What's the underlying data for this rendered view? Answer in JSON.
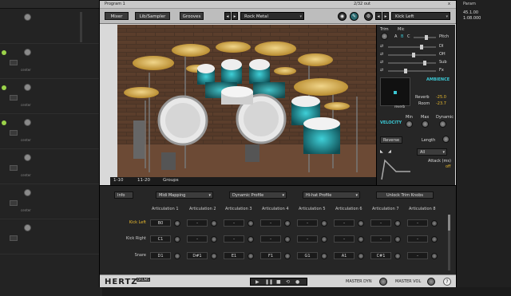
{
  "daw": {
    "top_left_label": "",
    "channel_label": "center",
    "transport": "Param",
    "right_time_1": "45.1.00",
    "right_time_2": "1:08.000"
  },
  "window": {
    "title": "Program 1",
    "io": "2/32 out",
    "close": "x"
  },
  "toolbar": {
    "mixer": "Mixer",
    "lib_sampler": "Lib/Sampler",
    "grooves": "Grooves",
    "kit_select": "Rock Metal",
    "articulation_select": "Kick Left"
  },
  "stage_tabs": [
    "1-10",
    "11-20",
    "Groups"
  ],
  "mixer": {
    "trim": "Trim",
    "mic": "Mic",
    "mic_buttons": [
      "A",
      "B",
      "C"
    ],
    "pitch": "Pitch",
    "sends": [
      "DI",
      "OH",
      "Sub",
      "Fx"
    ],
    "ambience": "AMBIENCE",
    "reverb_label": "reverb",
    "reverb": "Reverb",
    "reverb_value": "-25.0",
    "room": "Room",
    "room_value": "-23.7",
    "velocity": "VELOCITY",
    "min": "Min",
    "max": "Max",
    "dynamic": "Dynamic",
    "reverse": "Reverse",
    "length": "Length",
    "curve_select": "All",
    "attack": "Attack (ms)",
    "attack_value": "off"
  },
  "lower": {
    "info": "Info",
    "midi_mapping": "Midi Mapping",
    "dynamic_profile": "Dynamic Profile",
    "hihat_profile": "Hi-hat Profile",
    "unlock": "Unlock Trim Knobs",
    "columns": [
      "Articulation 1",
      "Articulation 2",
      "Articulation 3",
      "Articulation 4",
      "Articulation 5",
      "Articulation 6",
      "Articulation 7",
      "Articulation 8"
    ],
    "rows": [
      {
        "name": "Kick Left",
        "cells": [
          "B0",
          "-",
          "-",
          "-",
          "-",
          "-",
          "-",
          "-"
        ]
      },
      {
        "name": "Kick Right",
        "cells": [
          "C1",
          "-",
          "-",
          "-",
          "-",
          "-",
          "-",
          "-"
        ]
      },
      {
        "name": "Snare",
        "cells": [
          "D1",
          "D#1",
          "E1",
          "F1",
          "G1",
          "A1",
          "C#1",
          "-"
        ]
      }
    ]
  },
  "bottom": {
    "brand": "HERTZ",
    "brand_sub": "DRUMS",
    "master_dyn": "MASTER DYN",
    "master_vol": "MASTER VOL",
    "help": "?"
  },
  "colors": {
    "accent": "#3bc8d4",
    "highlight": "#e6b82e",
    "panel": "#262626"
  }
}
